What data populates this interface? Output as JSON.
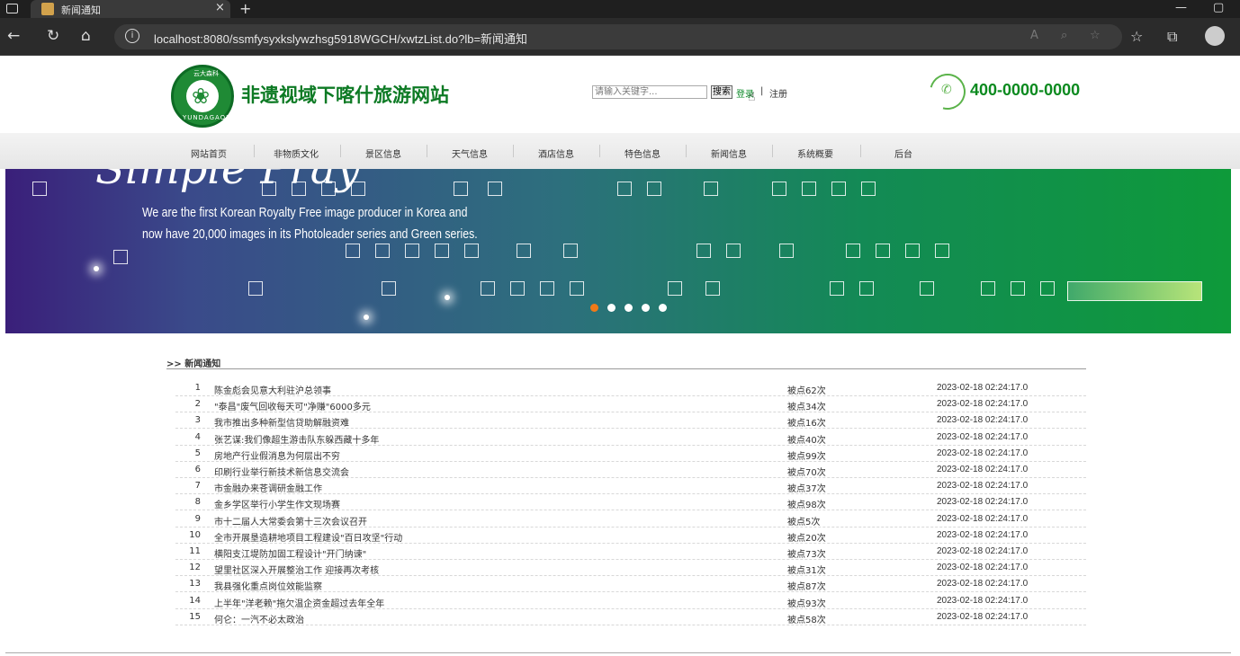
{
  "browser": {
    "tab_title": "新闻通知",
    "tab_close": "×",
    "new_tab": "+",
    "url": "localhost:8080/ssmfysyxkslywzhsg5918WGCH/xwtzList.do?lb=新闻通知",
    "info_icon": "i",
    "win_min": "—",
    "win_restore": "▢"
  },
  "header": {
    "logo_top": "云大森科",
    "logo_brand": "YUNDAGAOKE",
    "site_title": "非遗视域下喀什旅游网站",
    "search_placeholder": "请输入关键字...",
    "search_button": "搜索",
    "login": "登录",
    "separator": "|",
    "register": "注册",
    "phone": "400-0000-0000"
  },
  "nav": {
    "items": [
      {
        "label": "网站首页"
      },
      {
        "label": "非物质文化"
      },
      {
        "label": "景区信息"
      },
      {
        "label": "天气信息"
      },
      {
        "label": "酒店信息"
      },
      {
        "label": "特色信息"
      },
      {
        "label": "新闻信息"
      },
      {
        "label": "系统概要"
      },
      {
        "label": "后台"
      }
    ]
  },
  "banner": {
    "script_text": "Simple Pray",
    "line1": "We are the first Korean Royalty Free image producer in Korea and",
    "line2": "now have 20,000 images in its Photoleader series and Green series.",
    "dots_count": 5,
    "active_dot": 1
  },
  "list": {
    "heading": ">> 新闻通知",
    "rows": [
      {
        "no": "1",
        "title": "陈金彪会见意大利驻沪总领事",
        "clicks": "被点62次",
        "date": "2023-02-18 02:24:17.0"
      },
      {
        "no": "2",
        "title": "\"泰昌\"废气回收每天可\"净赚\"6000多元",
        "clicks": "被点34次",
        "date": "2023-02-18 02:24:17.0"
      },
      {
        "no": "3",
        "title": "我市推出多种新型信贷助解融资难",
        "clicks": "被点16次",
        "date": "2023-02-18 02:24:17.0"
      },
      {
        "no": "4",
        "title": "张艺谋:我们像超生游击队东躲西藏十多年",
        "clicks": "被点40次",
        "date": "2023-02-18 02:24:17.0"
      },
      {
        "no": "5",
        "title": "房地产行业假消息为何层出不穷",
        "clicks": "被点99次",
        "date": "2023-02-18 02:24:17.0"
      },
      {
        "no": "6",
        "title": "印刷行业举行新技术新信息交流会",
        "clicks": "被点70次",
        "date": "2023-02-18 02:24:17.0"
      },
      {
        "no": "7",
        "title": "市金融办来苍调研金融工作",
        "clicks": "被点37次",
        "date": "2023-02-18 02:24:17.0"
      },
      {
        "no": "8",
        "title": "金乡学区举行小学生作文现场赛",
        "clicks": "被点98次",
        "date": "2023-02-18 02:24:17.0"
      },
      {
        "no": "9",
        "title": "市十二届人大常委会第十三次会议召开",
        "clicks": "被点5次",
        "date": "2023-02-18 02:24:17.0"
      },
      {
        "no": "10",
        "title": "全市开展垦造耕地项目工程建设\"百日攻坚\"行动",
        "clicks": "被点20次",
        "date": "2023-02-18 02:24:17.0"
      },
      {
        "no": "11",
        "title": "横阳支江堤防加固工程设计\"开门纳谏\"",
        "clicks": "被点73次",
        "date": "2023-02-18 02:24:17.0"
      },
      {
        "no": "12",
        "title": "望里社区深入开展整治工作 迎接再次考核",
        "clicks": "被点31次",
        "date": "2023-02-18 02:24:17.0"
      },
      {
        "no": "13",
        "title": "我县强化重点岗位效能监察",
        "clicks": "被点87次",
        "date": "2023-02-18 02:24:17.0"
      },
      {
        "no": "14",
        "title": "上半年\"洋老赖\"拖欠温企资金超过去年全年",
        "clicks": "被点93次",
        "date": "2023-02-18 02:24:17.0"
      },
      {
        "no": "15",
        "title": "何仑：一汽不必太政治",
        "clicks": "被点58次",
        "date": "2023-02-18 02:24:17.0"
      }
    ]
  },
  "colors": {
    "brand_green": "#0d7a24",
    "phone_green": "#0b8a1f",
    "active_dot": "#f07a18"
  }
}
